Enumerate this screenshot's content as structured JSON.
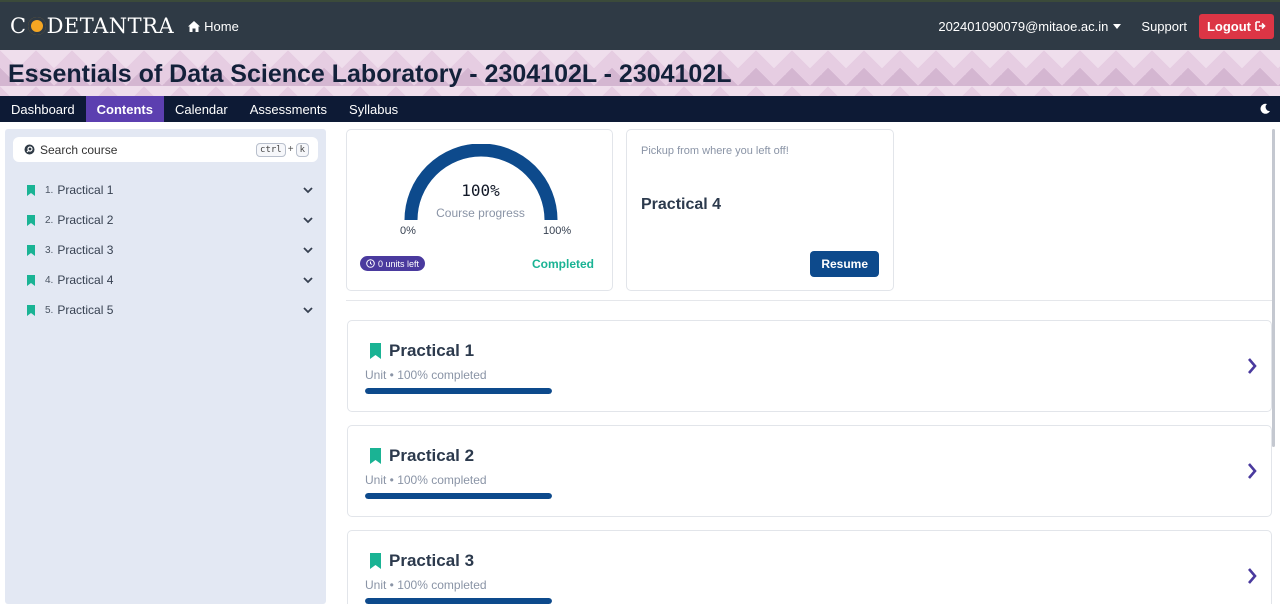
{
  "topbar": {
    "logo_prefix": "C",
    "logo_suffix": "DETANTRA",
    "home_label": "Home",
    "user_email": "202401090079@mitaoe.ac.in",
    "support_label": "Support",
    "logout_label": "Logout"
  },
  "banner": {
    "course_title": "Essentials of Data Science Laboratory - 2304102L - 2304102L"
  },
  "tabs": [
    {
      "label": "Dashboard",
      "active": false
    },
    {
      "label": "Contents",
      "active": true
    },
    {
      "label": "Calendar",
      "active": false
    },
    {
      "label": "Assessments",
      "active": false
    },
    {
      "label": "Syllabus",
      "active": false
    }
  ],
  "sidebar": {
    "search_placeholder": "Search course",
    "shortcut_key1": "ctrl",
    "shortcut_plus": "+",
    "shortcut_key2": "k",
    "items": [
      {
        "num": "1.",
        "label": "Practical 1"
      },
      {
        "num": "2.",
        "label": "Practical 2"
      },
      {
        "num": "3.",
        "label": "Practical 3"
      },
      {
        "num": "4.",
        "label": "Practical 4"
      },
      {
        "num": "5.",
        "label": "Practical 5"
      }
    ]
  },
  "progress": {
    "percent_label": "100%",
    "percent_value": 100,
    "subtitle": "Course progress",
    "min_label": "0%",
    "max_label": "100%",
    "units_left": "0 units left",
    "status": "Completed"
  },
  "resume": {
    "pickup_text": "Pickup from where you left off!",
    "title": "Practical 4",
    "button_label": "Resume"
  },
  "units": [
    {
      "title": "Practical 1",
      "subtitle": "Unit • 100% completed",
      "progress": 1.0
    },
    {
      "title": "Practical 2",
      "subtitle": "Unit • 100% completed",
      "progress": 1.0
    },
    {
      "title": "Practical 3",
      "subtitle": "Unit • 100% completed",
      "progress": 1.0
    }
  ],
  "colors": {
    "accent": "#5c3fb0",
    "progress_blue": "#0d4a8c",
    "bookmark_green": "#1ab394",
    "logout_red": "#dc3545"
  },
  "icons": {
    "home": "home-icon",
    "logout": "logout-icon",
    "theme": "moon-icon",
    "search": "search-icon",
    "bookmark": "bookmark-icon",
    "expand": "chevron-down-icon",
    "open": "chevron-right-icon"
  }
}
